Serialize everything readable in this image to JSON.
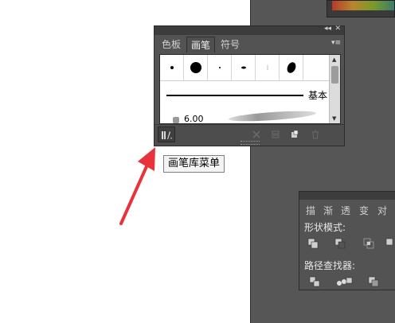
{
  "brushes_panel": {
    "tabs": [
      {
        "label": "色板",
        "active": false
      },
      {
        "label": "画笔",
        "active": true
      },
      {
        "label": "符号",
        "active": false
      }
    ],
    "title_controls": {
      "collapse": "◂◂",
      "close": "✕"
    },
    "menu_icon": "▾≡",
    "calligraphic_brushes": [
      "dot-small",
      "dot-large",
      "dot-tiny",
      "oval-small",
      "line-thin",
      "oval-large"
    ],
    "basic_brush_label": "基本",
    "art_brush_value": "6.00",
    "scroll": {
      "up": "▲",
      "down": "▼"
    }
  },
  "tooltip": {
    "text": "画笔库菜单"
  },
  "annotation": {
    "color": "#e8323c"
  },
  "second_panel": {
    "tabs": [
      "描",
      "渐",
      "透",
      "变",
      "对"
    ],
    "shape_modes_label": "形状模式:",
    "pathfinders_label": "路径查找器:"
  },
  "colors": {
    "workspace": "#565656",
    "panel": "#535353",
    "panel_dark": "#3c3c3c"
  }
}
